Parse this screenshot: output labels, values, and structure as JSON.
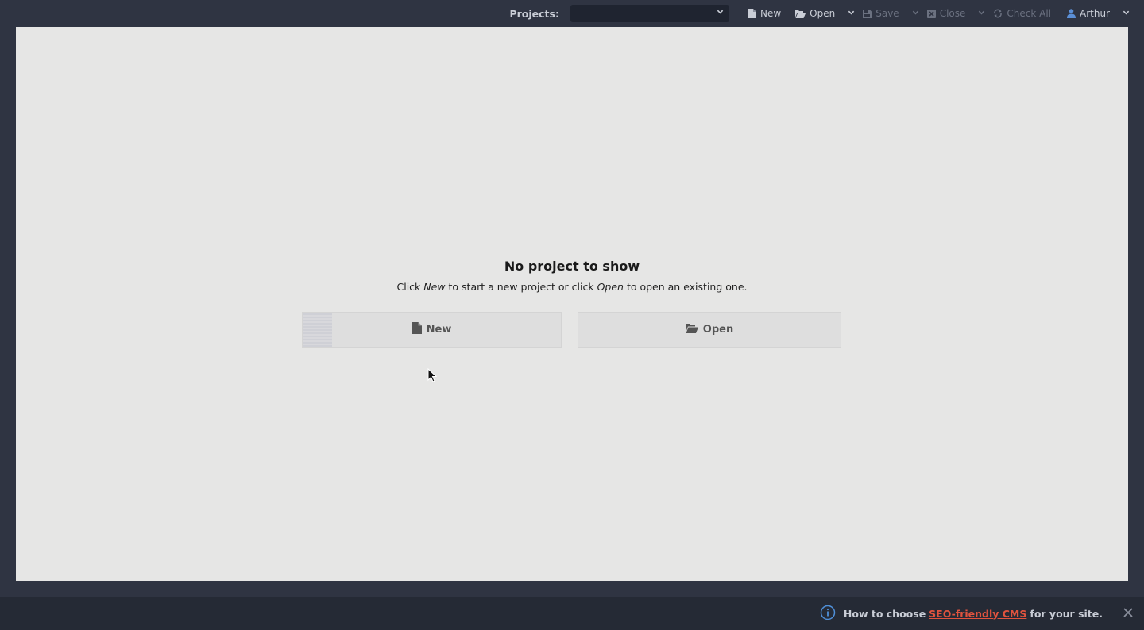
{
  "toolbar": {
    "projects_label": "Projects:",
    "projects_value": "",
    "new_label": "New",
    "open_label": "Open",
    "save_label": "Save",
    "close_label": "Close",
    "check_all_label": "Check All",
    "user_name": "Arthur"
  },
  "empty_state": {
    "title": "No project to show",
    "sub_before": "Click ",
    "sub_new": "New",
    "sub_middle": " to start a new project or click ",
    "sub_open": "Open",
    "sub_after": " to open an existing one.",
    "new_button_label": "New",
    "open_button_label": "Open"
  },
  "footer": {
    "text_before": "How to choose",
    "link_text": "SEO-friendly CMS",
    "text_after": "for your site."
  },
  "colors": {
    "app_background": "#2f3442",
    "workspace_background": "#e6e6e5",
    "footer_background": "#252a35",
    "link_color": "#e0533e",
    "info_icon_color": "#4f8fd8"
  },
  "icons": {
    "toolbar_new": "file-icon",
    "toolbar_open": "folder-open-icon",
    "toolbar_save": "floppy-disk-icon",
    "toolbar_close": "close-square-icon",
    "toolbar_check_all": "refresh-icon",
    "toolbar_user": "user-icon",
    "footer_info": "info-circle-icon",
    "footer_close": "close-icon"
  }
}
